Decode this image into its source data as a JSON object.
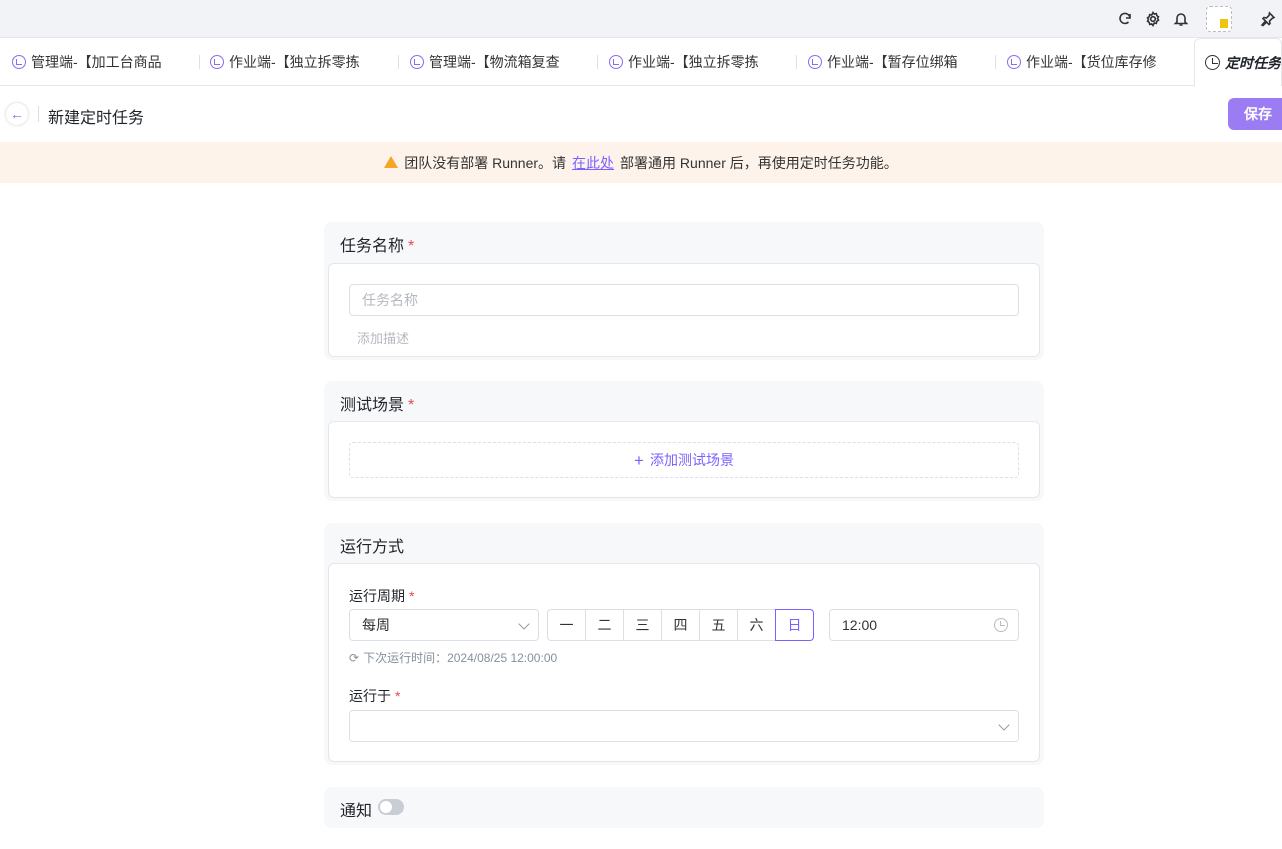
{
  "tabs": [
    {
      "label": "管理端-【加工台商品"
    },
    {
      "label": "作业端-【独立拆零拣"
    },
    {
      "label": "管理端-【物流箱复查"
    },
    {
      "label": "作业端-【独立拆零拣"
    },
    {
      "label": "作业端-【暂存位绑箱"
    },
    {
      "label": "作业端-【货位库存修"
    },
    {
      "label": "定时任务"
    }
  ],
  "header": {
    "title": "新建定时任务",
    "save_label": "保存"
  },
  "warning": {
    "before": "团队没有部署 Runner。请",
    "link": "在此处",
    "after": "部署通用 Runner 后，再使用定时任务功能。"
  },
  "task_name": {
    "title": "任务名称",
    "required": "*",
    "placeholder": "任务名称",
    "desc_placeholder": "添加描述"
  },
  "scenario": {
    "title": "测试场景",
    "required": "*",
    "add_label": "添加测试场景"
  },
  "run_mode": {
    "title": "运行方式",
    "period_label": "运行周期",
    "required": "*",
    "period_value": "每周",
    "days": [
      "一",
      "二",
      "三",
      "四",
      "五",
      "六",
      "日"
    ],
    "selected_day": "日",
    "time": "12:00",
    "next_run": "下次运行时间：2024/08/25 12:00:00",
    "run_on_label": "运行于"
  },
  "notify": {
    "title": "通知",
    "enabled": false
  },
  "colors": {
    "accent": "#7b61ff",
    "warning_bg": "#fdf3ea",
    "warning_icon": "#f5a623"
  }
}
